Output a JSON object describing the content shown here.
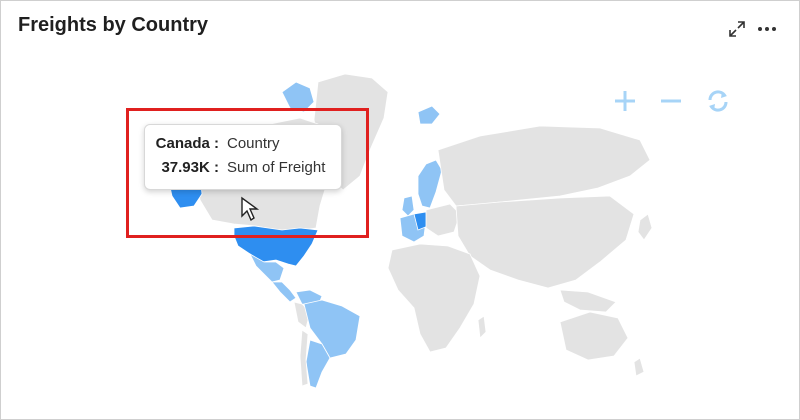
{
  "widget": {
    "title": "Freights by Country",
    "header_icons": [
      "expand-icon",
      "more-options-icon"
    ]
  },
  "map_controls": {
    "icons": [
      "zoom-in-icon",
      "zoom-out-icon",
      "reset-view-icon"
    ],
    "color": "#a7d4f7"
  },
  "colors": {
    "land_default": "#e3e3e3",
    "data_light": "#8fc4f5",
    "data_mid": "#5fa9ef",
    "data_dark": "#2e8ef0",
    "highlight_border": "#e0201f"
  },
  "tooltip": {
    "row1": {
      "key": "Canada :",
      "value": "Country"
    },
    "row2": {
      "key": "37.93K :",
      "value": "Sum of Freight"
    }
  }
}
